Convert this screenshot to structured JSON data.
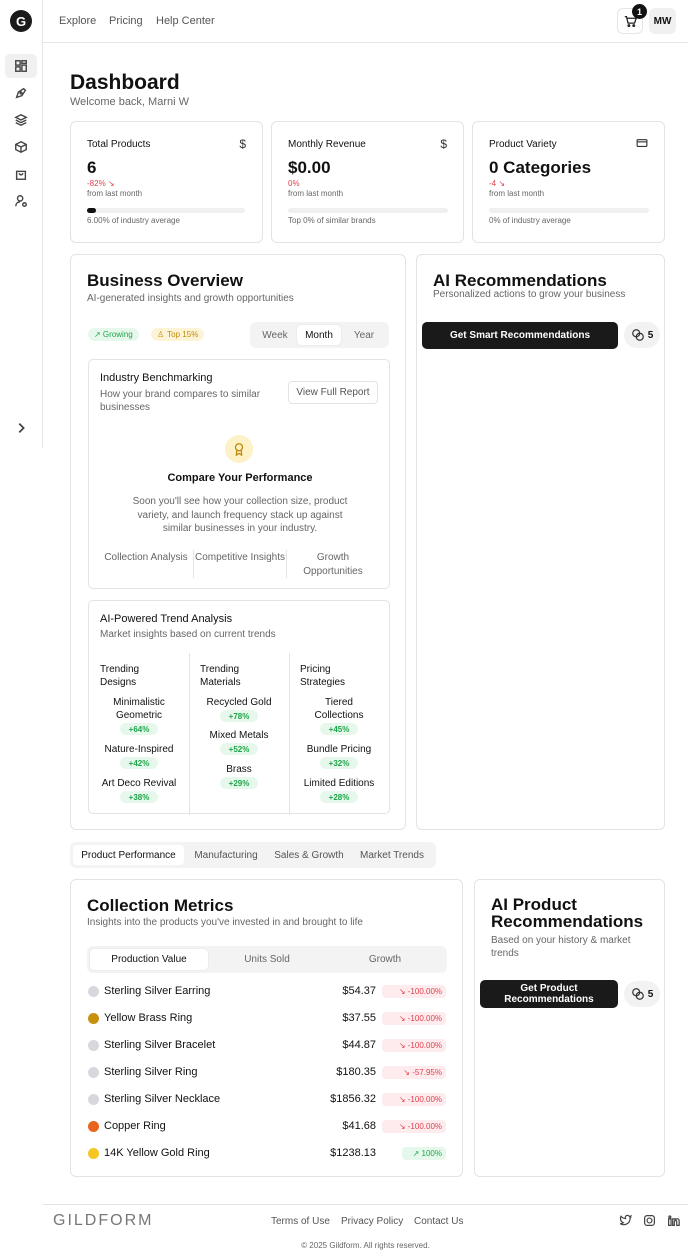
{
  "brand": {
    "logo_letter": "G",
    "wordmark": "GILDFORM"
  },
  "header": {
    "nav": [
      "Explore",
      "Pricing",
      "Help Center"
    ],
    "cart_count": "1",
    "avatar_initials": "MW"
  },
  "sidebar": {
    "items": [
      "dashboard-icon",
      "pen-tool-icon",
      "layers-icon",
      "box-icon",
      "shopping-bag-icon",
      "user-search-icon"
    ],
    "expand": "chevron-right-icon"
  },
  "page": {
    "title": "Dashboard",
    "welcome": "Welcome back, Marni W"
  },
  "stats": [
    {
      "title": "Total Products",
      "icon": "$",
      "value": "6",
      "change": "-82% ↘",
      "sub": "from last month",
      "progress": 0.06,
      "foot": "6.00% of industry average"
    },
    {
      "title": "Monthly Revenue",
      "icon": "$",
      "value": "$0.00",
      "change": "0%",
      "sub": "from last month",
      "progress": 0,
      "foot": "Top 0% of similar brands"
    },
    {
      "title": "Product Variety",
      "icon": "card",
      "value": "0 Categories",
      "change": "-4 ↘",
      "sub": "from last month",
      "progress": 0,
      "foot": "0% of industry average"
    }
  ],
  "overview": {
    "title": "Business Overview",
    "subtitle": "AI-generated insights and growth opportunities",
    "badges": [
      "↗ Growing",
      "Top 15%"
    ],
    "periods": [
      "Week",
      "Month",
      "Year"
    ],
    "active_period": "Month",
    "benchmark": {
      "title": "Industry Benchmarking",
      "subtitle": "How your brand compares to similar businesses",
      "button": "View Full Report",
      "compare_title": "Compare Your Performance",
      "compare_text": "Soon you'll see how your collection size, product variety, and launch frequency stack up against similar businesses in your industry.",
      "features": [
        "Collection Analysis",
        "Competitive Insights",
        "Growth Opportunities"
      ]
    },
    "trends": {
      "title": "AI-Powered Trend Analysis",
      "subtitle": "Market insights based on current trends",
      "columns": [
        {
          "title": "Trending Designs",
          "items": [
            {
              "name": "Minimalistic Geometric",
              "change": "+64%"
            },
            {
              "name": "Nature-Inspired",
              "change": "+42%"
            },
            {
              "name": "Art Deco Revival",
              "change": "+38%"
            }
          ]
        },
        {
          "title": "Trending Materials",
          "items": [
            {
              "name": "Recycled Gold",
              "change": "+78%"
            },
            {
              "name": "Mixed Metals",
              "change": "+52%"
            },
            {
              "name": "Brass",
              "change": "+29%"
            }
          ]
        },
        {
          "title": "Pricing Strategies",
          "items": [
            {
              "name": "Tiered Collections",
              "change": "+45%"
            },
            {
              "name": "Bundle Pricing",
              "change": "+32%"
            },
            {
              "name": "Limited Editions",
              "change": "+28%"
            }
          ]
        }
      ]
    }
  },
  "ai_recs": {
    "title": "AI Recommendations",
    "subtitle": "Personalized actions to grow your business",
    "button": "Get Smart Recommendations",
    "credits": "5"
  },
  "tabs": [
    "Product Performance",
    "Manufacturing",
    "Sales & Growth",
    "Market Trends"
  ],
  "metrics": {
    "title": "Collection Metrics",
    "subtitle": "Insights into the products you've invested in and brought to life",
    "segments": [
      "Production Value",
      "Units Sold",
      "Growth"
    ],
    "rows": [
      {
        "name": "Sterling Silver Earring",
        "value": "$54.37",
        "change": "↘ -100.00%",
        "color": "#d7d8de",
        "positive": false
      },
      {
        "name": "Yellow Brass Ring",
        "value": "$37.55",
        "change": "↘ -100.00%",
        "color": "#c8900f",
        "positive": false
      },
      {
        "name": "Sterling Silver Bracelet",
        "value": "$44.87",
        "change": "↘ -100.00%",
        "color": "#d7d8de",
        "positive": false
      },
      {
        "name": "Sterling Silver Ring",
        "value": "$180.35",
        "change": "↘ -57.95%",
        "color": "#d7d8de",
        "positive": false
      },
      {
        "name": "Sterling Silver Necklace",
        "value": "$1856.32",
        "change": "↘ -100.00%",
        "color": "#d7d8de",
        "positive": false
      },
      {
        "name": "Copper Ring",
        "value": "$41.68",
        "change": "↘ -100.00%",
        "color": "#e8651b",
        "positive": false
      },
      {
        "name": "14K Yellow Gold Ring",
        "value": "$1238.13",
        "change": "↗ 100%",
        "color": "#f3c623",
        "positive": true
      }
    ]
  },
  "product_recs": {
    "title": "AI Product Recommendations",
    "subtitle": "Based on your history & market trends",
    "button": "Get Product Recommendations",
    "credits": "5"
  },
  "footer": {
    "links": [
      "Terms of Use",
      "Privacy Policy",
      "Contact Us"
    ],
    "copyright": "© 2025 Gildform. All rights reserved."
  }
}
